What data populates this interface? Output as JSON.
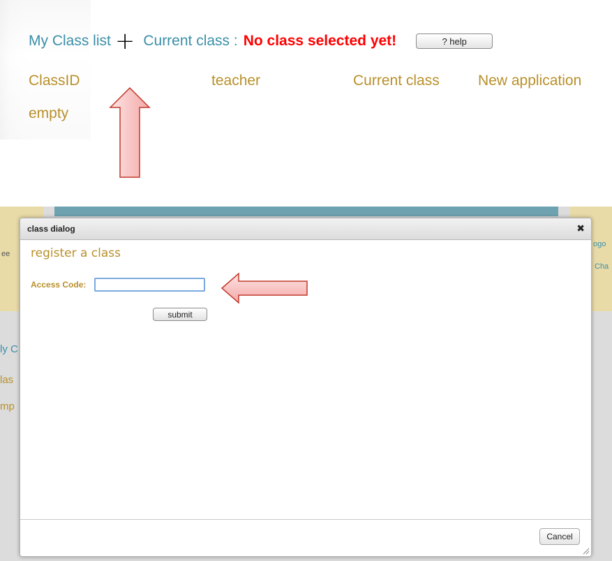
{
  "top": {
    "class_list_label": "My Class list",
    "plus_symbol": "+",
    "current_class_label": "Current class :",
    "current_class_status": "No class selected yet!",
    "help_label": "? help",
    "columns": [
      "ClassID",
      "teacher",
      "Current class",
      "New application"
    ],
    "empty_text": "empty"
  },
  "background": {
    "fragments": [
      "ee",
      "ly C",
      "las",
      "mp",
      "ogo",
      "Cha"
    ]
  },
  "dialog": {
    "title": "class dialog",
    "close_symbol": "✖",
    "heading": "register a class",
    "access_code_label": "Access Code:",
    "access_code_value": "",
    "submit_label": "submit",
    "cancel_label": "Cancel"
  },
  "colors": {
    "teal": "#3a8fa8",
    "gold": "#b8902a",
    "status_red": "#ff0000",
    "arrow_fill": "#f8c4c4",
    "arrow_stroke": "#c0392b"
  },
  "icons": [
    "plus-icon",
    "close-icon",
    "resize-grip-icon",
    "arrow-up-icon",
    "arrow-left-icon"
  ]
}
